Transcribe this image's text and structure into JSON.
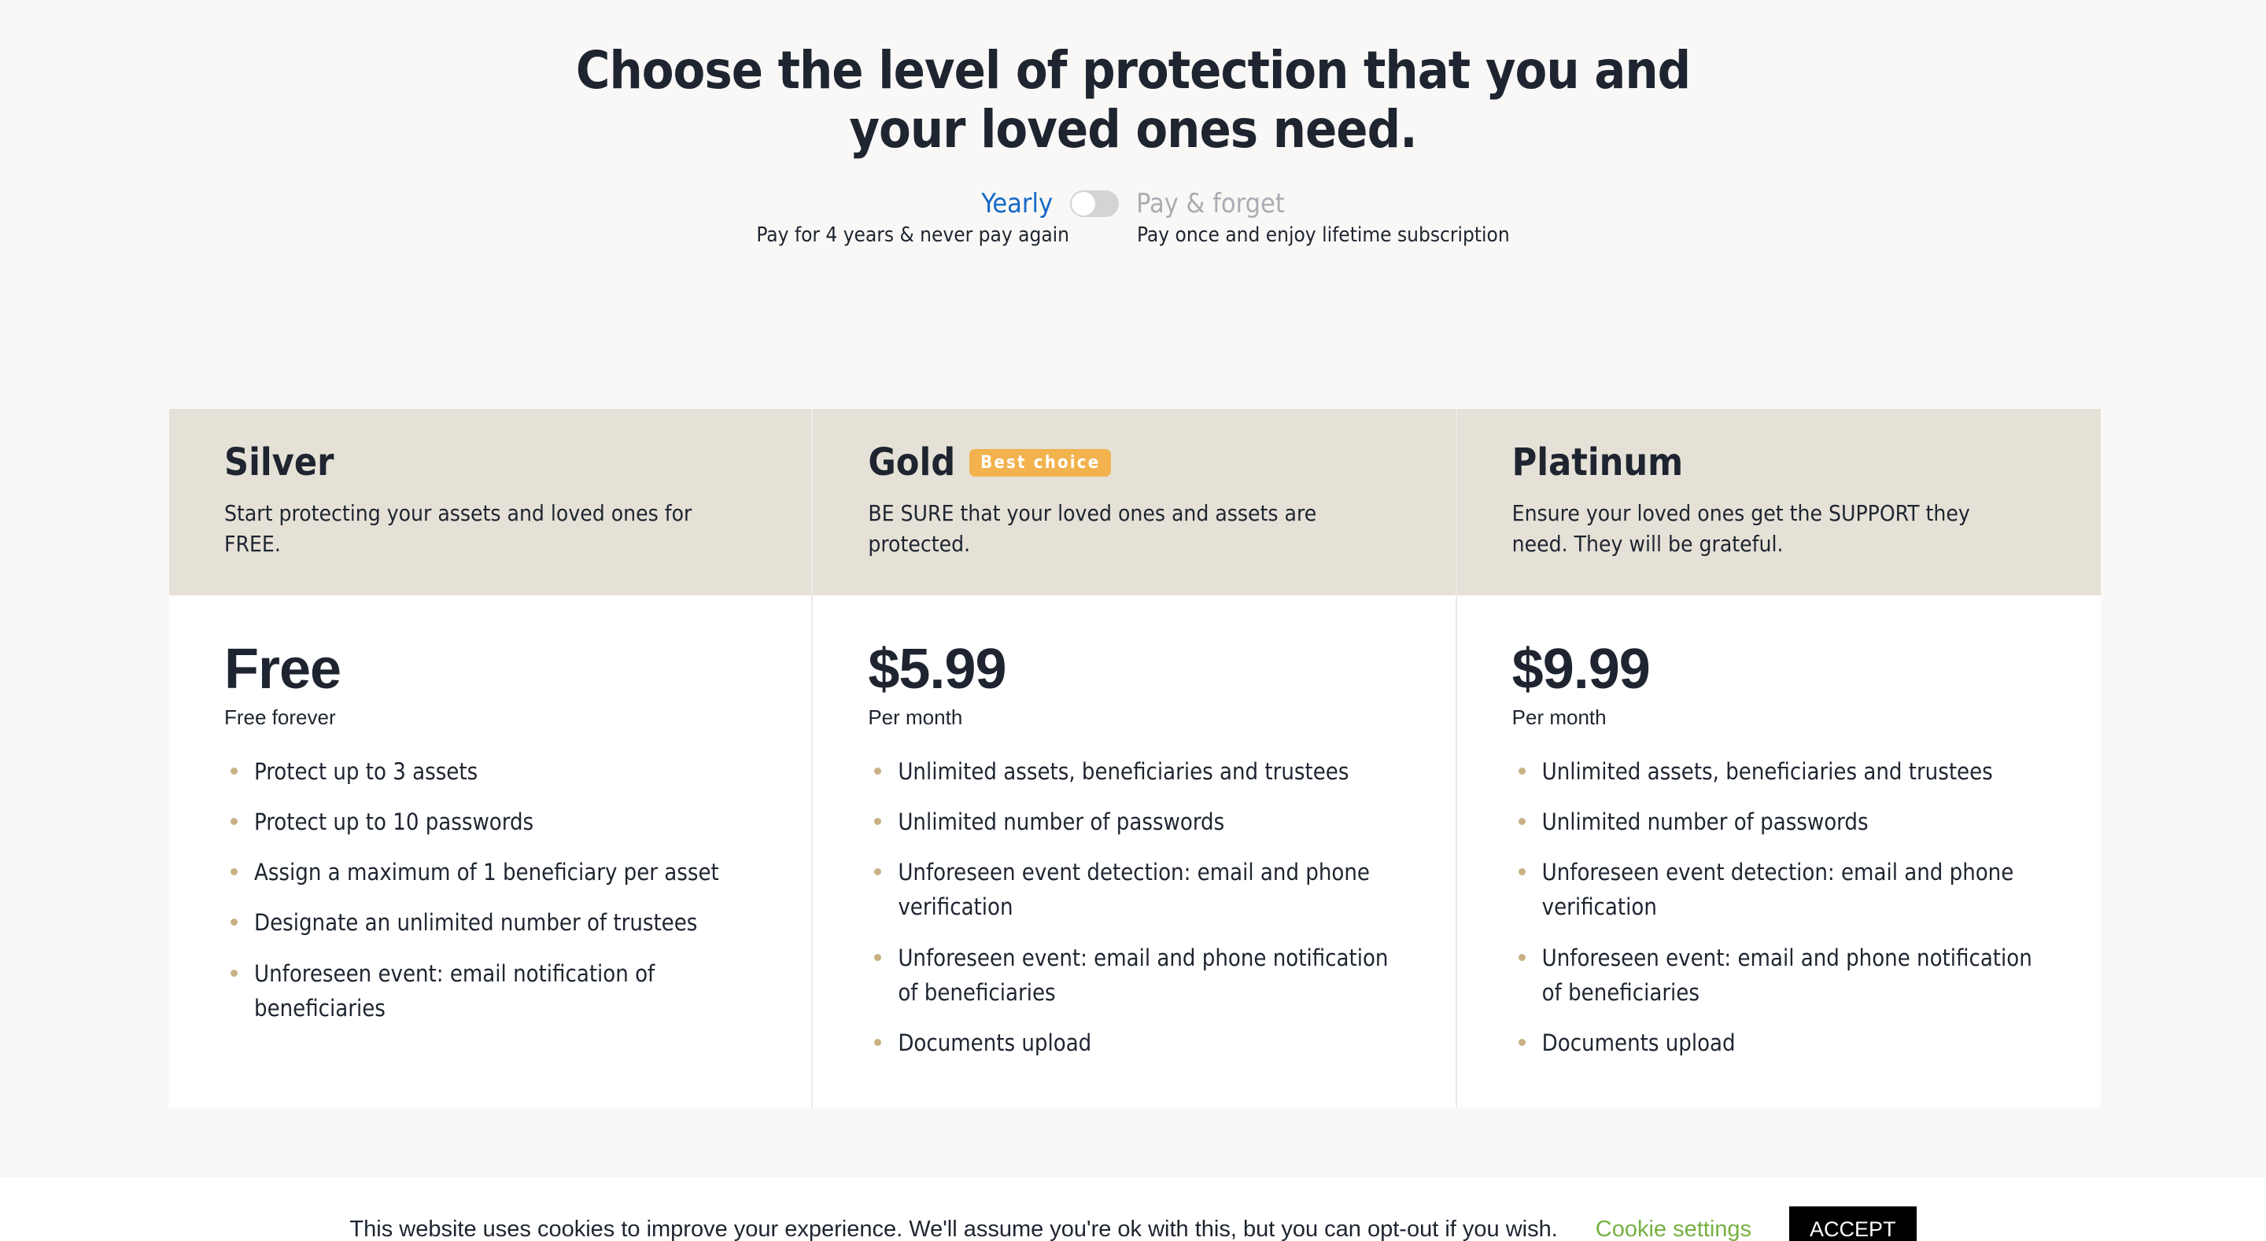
{
  "heading": {
    "line1": "Choose the level of protection that you and",
    "line2": "your loved ones need."
  },
  "billing": {
    "left_label": "Yearly",
    "right_label": "Pay & forget",
    "left_caption": "Pay for 4 years & never pay again",
    "right_caption": "Pay once and enjoy lifetime subscription",
    "active": "Yearly",
    "active_color": "#1668c9",
    "inactive_color": "#a9adb3",
    "track_color": "#d4d4d4",
    "knob_color": "#ffffff"
  },
  "plans": [
    {
      "name": "Silver",
      "badge": null,
      "tagline": "Start protecting your assets and loved ones for FREE.",
      "price": "Free",
      "period": "Free forever",
      "features": [
        "Protect up to 3 assets",
        "Protect up to 10 passwords",
        "Assign a maximum of 1 beneficiary per asset",
        "Designate an unlimited number of trustees",
        "Unforeseen event: email notification of beneficiaries"
      ]
    },
    {
      "name": "Gold",
      "badge": "Best choice",
      "tagline": "BE SURE that your loved ones and assets are protected.",
      "price": "$5.99",
      "period": "Per month",
      "features": [
        "Unlimited assets, beneficiaries and trustees",
        "Unlimited number of passwords",
        "Unforeseen event detection: email and phone verification",
        "Unforeseen event: email and phone notification of beneficiaries",
        "Documents upload"
      ]
    },
    {
      "name": "Platinum",
      "badge": null,
      "tagline": "Ensure your loved ones get the SUPPORT they need. They will be grateful.",
      "price": "$9.99",
      "period": "Per month",
      "features": [
        "Unlimited assets, beneficiaries and trustees",
        "Unlimited number of passwords",
        "Unforeseen event detection: email and phone verification",
        "Unforeseen event: email and phone notification of beneficiaries",
        "Documents upload"
      ]
    }
  ],
  "cookie": {
    "message": "This website uses cookies to improve your experience. We'll assume you're ok with this, but you can opt-out if you wish.",
    "settings_label": "Cookie settings",
    "accept_label": "ACCEPT",
    "link_color": "#76b041",
    "button_bg": "#000000"
  },
  "theme": {
    "page_bg": "#f9f8f6",
    "card_bg": "#ffffff",
    "header_bg": "#e6e1d7",
    "text": "#1e2530",
    "badge_bg": "#f2b24d",
    "bullet": "#c8b184"
  }
}
